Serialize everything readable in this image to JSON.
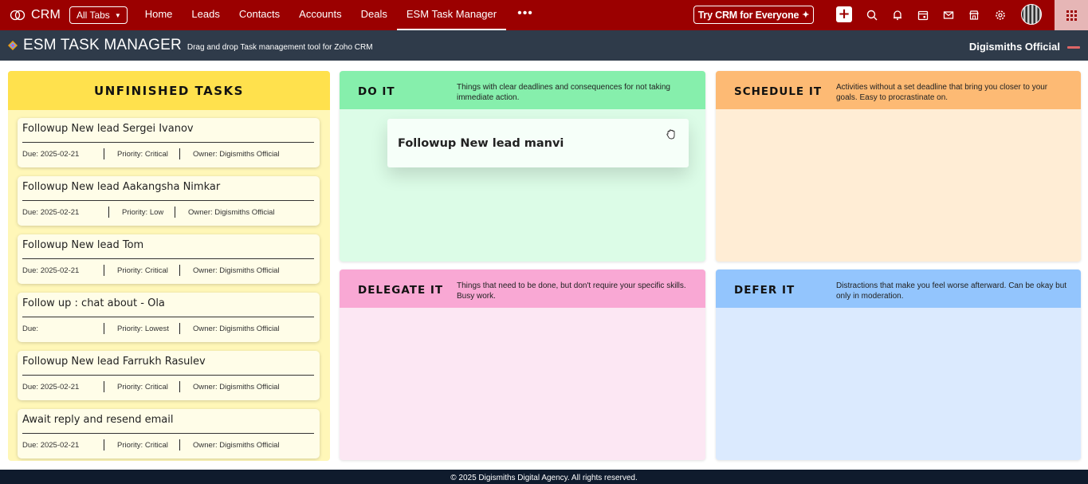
{
  "topnav": {
    "brand": "CRM",
    "all_tabs": "All Tabs",
    "items": [
      "Home",
      "Leads",
      "Contacts",
      "Accounts",
      "Deals",
      "ESM Task Manager"
    ],
    "active": "ESM Task Manager",
    "more": "•••",
    "try_crm": "Try CRM for Everyone",
    "accent": "#9b0000"
  },
  "subheader": {
    "title": "ESM TASK MANAGER",
    "tagline": "Drag and drop Task management tool for Zoho CRM",
    "user": "Digismiths Official"
  },
  "unfinished": {
    "title": "UNFINISHED TASKS",
    "tasks": [
      {
        "title": "Followup New lead Sergei Ivanov",
        "due": "Due: 2025-02-21",
        "priority": "Priority: Critical",
        "owner": "Owner: Digismiths Official"
      },
      {
        "title": "Followup New lead Aakangsha Nimkar",
        "due": "Due: 2025-02-21",
        "priority": "Priority: Low",
        "owner": "Owner: Digismiths Official"
      },
      {
        "title": "Followup New lead Tom",
        "due": "Due: 2025-02-21",
        "priority": "Priority: Critical",
        "owner": "Owner: Digismiths Official"
      },
      {
        "title": "Follow up : chat about - Ola",
        "due": "Due:",
        "priority": "Priority: Lowest",
        "owner": "Owner: Digismiths Official"
      },
      {
        "title": "Followup New lead Farrukh Rasulev",
        "due": "Due: 2025-02-21",
        "priority": "Priority: Critical",
        "owner": "Owner: Digismiths Official"
      },
      {
        "title": "Await reply and resend email",
        "due": "Due: 2025-02-21",
        "priority": "Priority: Critical",
        "owner": "Owner: Digismiths Official"
      }
    ]
  },
  "quadrants": {
    "do": {
      "title": "DO IT",
      "desc": "Things with clear deadlines and consequences for not taking immediate action.",
      "color": "#86efac"
    },
    "schedule": {
      "title": "SCHEDULE IT",
      "desc": "Activities without a set deadline that bring you closer to your goals. Easy to procrastinate on.",
      "color": "#fdba74"
    },
    "delegate": {
      "title": "DELEGATE IT",
      "desc": "Things that need to be done, but don't require your specific skills. Busy work.",
      "color": "#f9a8d4"
    },
    "defer": {
      "title": "DEFER IT",
      "desc": "Distractions that make you feel worse afterward. Can be okay but only in moderation.",
      "color": "#93c5fd"
    }
  },
  "dragging_card": {
    "title": "Followup New lead manvi"
  },
  "footer": {
    "text": "© 2025 Digismiths Digital Agency. All rights reserved."
  }
}
